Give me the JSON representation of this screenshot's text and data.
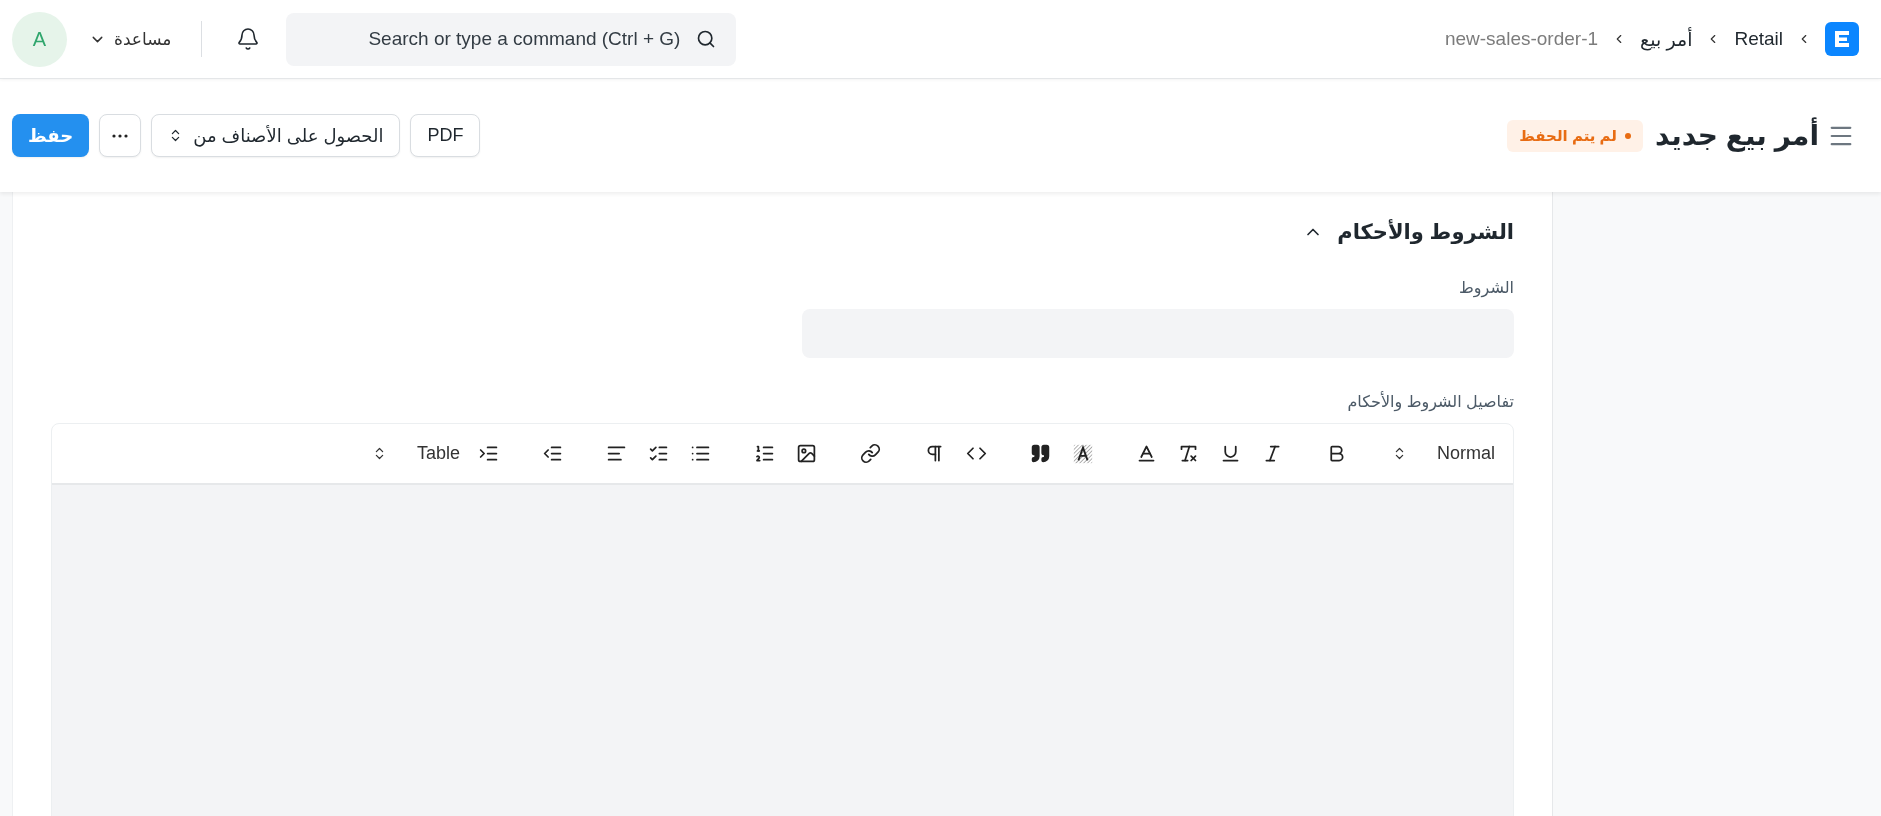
{
  "navbar": {
    "breadcrumbs": [
      {
        "label": "Retail",
        "current": false
      },
      {
        "label": "أمر بيع",
        "current": false
      },
      {
        "label": "new-sales-order-1",
        "current": true
      }
    ],
    "search": {
      "placeholder": "Search or type a command (Ctrl + G)"
    },
    "help": {
      "label": "مساعدة"
    },
    "avatar": {
      "initial": "A"
    }
  },
  "header": {
    "title": "أمر بيع جديد",
    "status": "لم يتم الحفظ",
    "buttons": [
      {
        "kind": "plain",
        "label": "PDF"
      },
      {
        "kind": "select",
        "label": "الحصول على الأصناف من"
      },
      {
        "kind": "more"
      },
      {
        "kind": "primary",
        "label": "حفظ"
      }
    ]
  },
  "section": {
    "title": "الشروط والأحكام",
    "expanded": true,
    "terms_field": {
      "label": "الشروط"
    },
    "editor": {
      "label": "تفاصيل الشروط والأحكام",
      "toolbar": [
        {
          "kind": "select",
          "label": "Normal"
        },
        {
          "kind": "bold"
        },
        {
          "kind": "italic"
        },
        {
          "kind": "underline"
        },
        {
          "kind": "clear"
        },
        {
          "kind": "color"
        },
        {
          "kind": "background"
        },
        {
          "kind": "quote"
        },
        {
          "kind": "code"
        },
        {
          "kind": "direction"
        },
        {
          "kind": "link"
        },
        {
          "kind": "image"
        },
        {
          "kind": "ordered"
        },
        {
          "kind": "bullet"
        },
        {
          "kind": "check"
        },
        {
          "kind": "align"
        },
        {
          "kind": "outdent"
        },
        {
          "kind": "indent"
        },
        {
          "kind": "select",
          "label": "Table"
        }
      ]
    }
  }
}
